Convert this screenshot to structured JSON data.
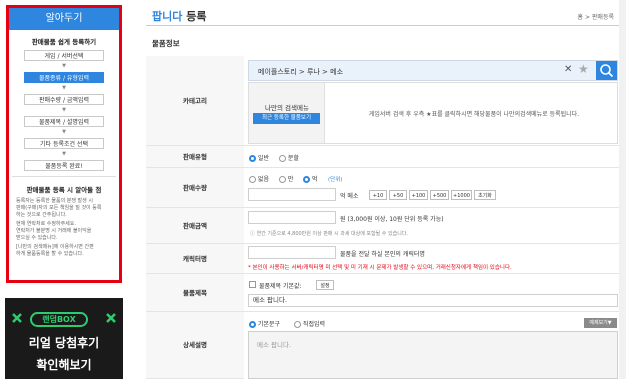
{
  "sidebar": {
    "header": "알아두기",
    "guide_title": "판매물품 쉽게 등록하기",
    "steps": [
      "게임 / 서버선택",
      "물품종류 / 유형입력",
      "판매수량 / 금액입력",
      "물품제목 / 설명입력",
      "기타 등록조건 선택",
      "물품등록 완료!"
    ],
    "notice_title": "판매물품 등록 시 알아둘 점",
    "notice_lines": [
      "등록자는 등록한 물품의 분쟁 발생 시",
      "판매(구매)자의 모든 책임을 질 것이 등록",
      "하는 것으로 간주됩니다.",
      "현재 연락처로 수정하주세요.",
      "연락처가 불분명 시 거래에 불이익을",
      "받으실 수 있습니다.",
      "[나만의 검색메뉴]에 이용하시면 간편",
      "하게 물품등록을 할 수 있습니다."
    ],
    "ad_line1": "랜덤BOX",
    "ad_line2": "리얼 당첨후기",
    "ad_line3": "확인해보기"
  },
  "header": {
    "title_blue": "팝니다",
    "title_rest": "등록",
    "breadcrumb": "홈 > 판매등록"
  },
  "section_title": "물품정보",
  "category": {
    "label": "카테고리",
    "path": "메이플스토리 > 루나 > 메소",
    "my_menu_title": "나만의 검색메뉴",
    "my_menu_button": "최근 등록한 물품보기",
    "hint": "게임서버 검색 후 우측 ★표를 클릭하시면 해당물품이 나만의검색메뉴로 등록됩니다."
  },
  "sale_type": {
    "label": "판매유형",
    "options": [
      "일반",
      "분할"
    ],
    "selected": 0
  },
  "quantity": {
    "label": "판매수량",
    "units": [
      "없음",
      "만",
      "억"
    ],
    "unit_selected": 2,
    "unit_link": "(단위)",
    "value": "",
    "suffix": "억 메소",
    "buttons": [
      "+10",
      "+50",
      "+100",
      "+500",
      "+1000",
      "초기화"
    ]
  },
  "price": {
    "label": "판매금액",
    "value": "",
    "suffix": "원 (3,000원 이상, 10원 단위 등록 가능)",
    "note": "ⓘ 연간 기준으로 4,800만원 이상 판매 시 과세 대상에 포함될 수 있습니다."
  },
  "character": {
    "label": "캐릭터명",
    "value": "",
    "suffix": "물품을 전달 하실 본인의 캐릭터명",
    "warning": "* 본인이 사용하는 서버/캐릭터명 미 선택 및 미 기재 시 문제가 발생할 수 있으며, 거래신청자에게 책임이 있습니다."
  },
  "item_title": {
    "label": "물품제목",
    "checkbox_label": "물품제목 기본값:",
    "setting_button": "설정",
    "value": "메소 팝니다."
  },
  "description": {
    "label": "상세설명",
    "options": [
      "기본문구",
      "직접입력"
    ],
    "selected": 0,
    "examples_button": "예제보기▼",
    "placeholder": "메소 팝니다."
  },
  "colors": {
    "accent": "#2e86de",
    "highlight_frame": "#e60012"
  }
}
